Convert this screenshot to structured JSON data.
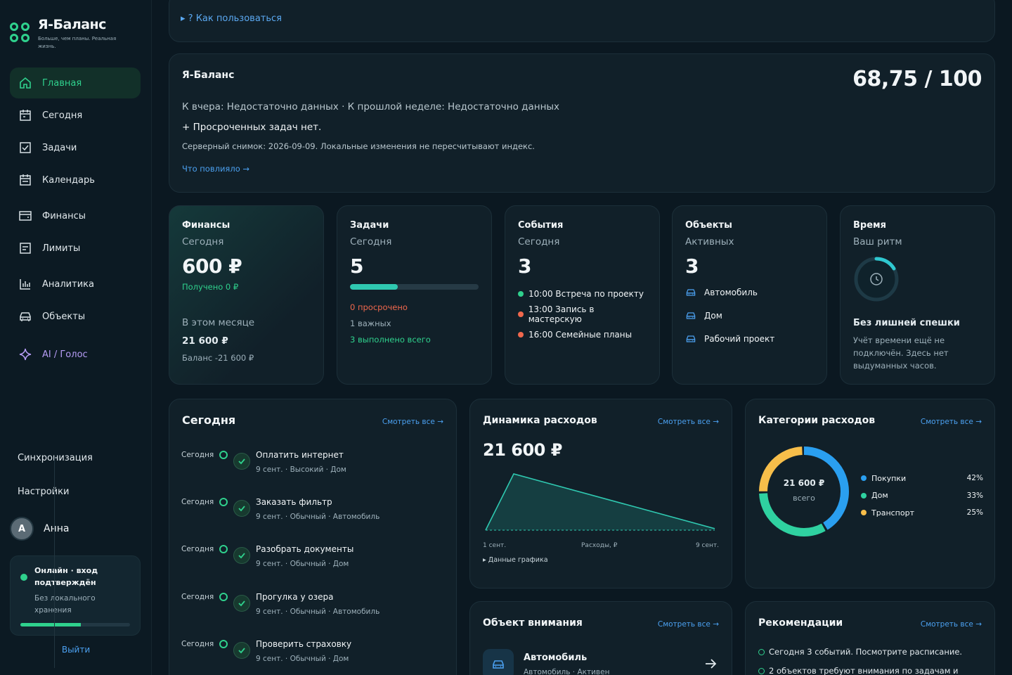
{
  "brand": {
    "name": "Я-Баланс",
    "tagline": "Больше, чем планы. Реальная жизнь."
  },
  "nav": [
    {
      "label": "Главная",
      "icon": "home-icon"
    },
    {
      "label": "Сегодня",
      "icon": "calendar-day-icon"
    },
    {
      "label": "Задачи",
      "icon": "checkbox-icon"
    },
    {
      "label": "Календарь",
      "icon": "calendar-icon"
    },
    {
      "label": "Финансы",
      "icon": "wallet-icon"
    },
    {
      "label": "Лимиты",
      "icon": "list-icon"
    },
    {
      "label": "Аналитика",
      "icon": "bar-chart-icon"
    },
    {
      "label": "Объекты",
      "icon": "car-icon"
    },
    {
      "label": "AI / Голос",
      "icon": "sparkle-icon"
    }
  ],
  "sidebar": {
    "sync": "Синхронизация",
    "settings": "Настройки",
    "user": {
      "initial": "А",
      "name": "Анна"
    },
    "status": {
      "title": "Онлайн · вход подтверждён",
      "subtitle": "Без локального хранения",
      "progress": 0.55
    },
    "logout": "Выйти"
  },
  "howto": "▸ ? Как пользоваться",
  "hero": {
    "title": "Я-Баланс",
    "score": "68,75 / 100",
    "line1": "К вчера: Недостаточно данных · К прошлой неделе: Недостаточно данных",
    "line2": "+ Просроченных задач нет.",
    "line3": "Серверный снимок: 2026-09-09. Локальные изменения не пересчитывают индекс.",
    "link": "Что повлияло →"
  },
  "stats": {
    "finance": {
      "title": "Финансы",
      "sub": "Сегодня",
      "value": "600 ₽",
      "received": "Получено 0 ₽",
      "month_label": "В этом месяце",
      "month_value": "21 600 ₽",
      "balance": "Баланс -21 600 ₽"
    },
    "tasks": {
      "title": "Задачи",
      "sub": "Сегодня",
      "value": "5",
      "progress": 0.37,
      "overdue": "0 просрочено",
      "important": "1 важных",
      "done": "3 выполнено всего"
    },
    "events": {
      "title": "События",
      "sub": "Сегодня",
      "value": "3",
      "items": [
        {
          "text": "10:00 Встреча по проекту",
          "color": "#2fd18d"
        },
        {
          "text": "13:00 Запись в мастерскую",
          "color": "#f0684d"
        },
        {
          "text": "16:00 Семейные планы",
          "color": "#f0684d"
        }
      ]
    },
    "objects": {
      "title": "Объекты",
      "sub": "Активных",
      "value": "3",
      "items": [
        "Автомобиль",
        "Дом",
        "Рабочий проект"
      ]
    },
    "time": {
      "title": "Время",
      "sub": "Ваш ритм",
      "heading": "Без лишней спешки",
      "text": "Учёт времени ещё не подключён. Здесь нет выдуманных часов."
    }
  },
  "today": {
    "title": "Сегодня",
    "link": "Смотреть все →",
    "tasks": [
      {
        "when": "Сегодня",
        "name": "Оплатить интернет",
        "meta": "9 сент. · Высокий · Дом"
      },
      {
        "when": "Сегодня",
        "name": "Заказать фильтр",
        "meta": "9 сент. · Обычный · Автомобиль"
      },
      {
        "when": "Сегодня",
        "name": "Разобрать документы",
        "meta": "9 сент. · Обычный · Дом"
      },
      {
        "when": "Сегодня",
        "name": "Прогулка у озера",
        "meta": "9 сент. · Обычный · Автомобиль"
      },
      {
        "when": "Сегодня",
        "name": "Проверить страховку",
        "meta": "9 сент. · Обычный · Дом"
      }
    ]
  },
  "dynamics": {
    "title": "Динамика расходов",
    "link": "Смотреть все →",
    "total": "21 600 ₽",
    "note": "▸ Данные графика"
  },
  "chart_data": {
    "type": "area",
    "x": [
      "1 сент.",
      "2 сент.",
      "9 сент."
    ],
    "values": [
      0,
      21600,
      600
    ],
    "xlabel_start": "1 сент.",
    "xlabel_end": "9 сент.",
    "legend": "Расходы, ₽",
    "color": "#2fc8b0"
  },
  "categories": {
    "title": "Категории расходов",
    "link": "Смотреть все →",
    "center_value": "21 600 ₽",
    "center_label": "всего",
    "items": [
      {
        "name": "Покупки",
        "pct": "42%",
        "share": 42,
        "color": "#2a9ff0"
      },
      {
        "name": "Дом",
        "pct": "33%",
        "share": 33,
        "color": "#2fd1a0"
      },
      {
        "name": "Транспорт",
        "pct": "25%",
        "share": 25,
        "color": "#f7be4a"
      }
    ]
  },
  "focus": {
    "title": "Объект внимания",
    "link": "Смотреть все →",
    "name": "Автомобиль",
    "sub": "Автомобиль · Активен"
  },
  "recs": {
    "title": "Рекомендации",
    "link": "Смотреть все →",
    "items": [
      "Сегодня 3 событий. Посмотрите расписание.",
      "2 объектов требуют внимания по задачам и"
    ]
  }
}
